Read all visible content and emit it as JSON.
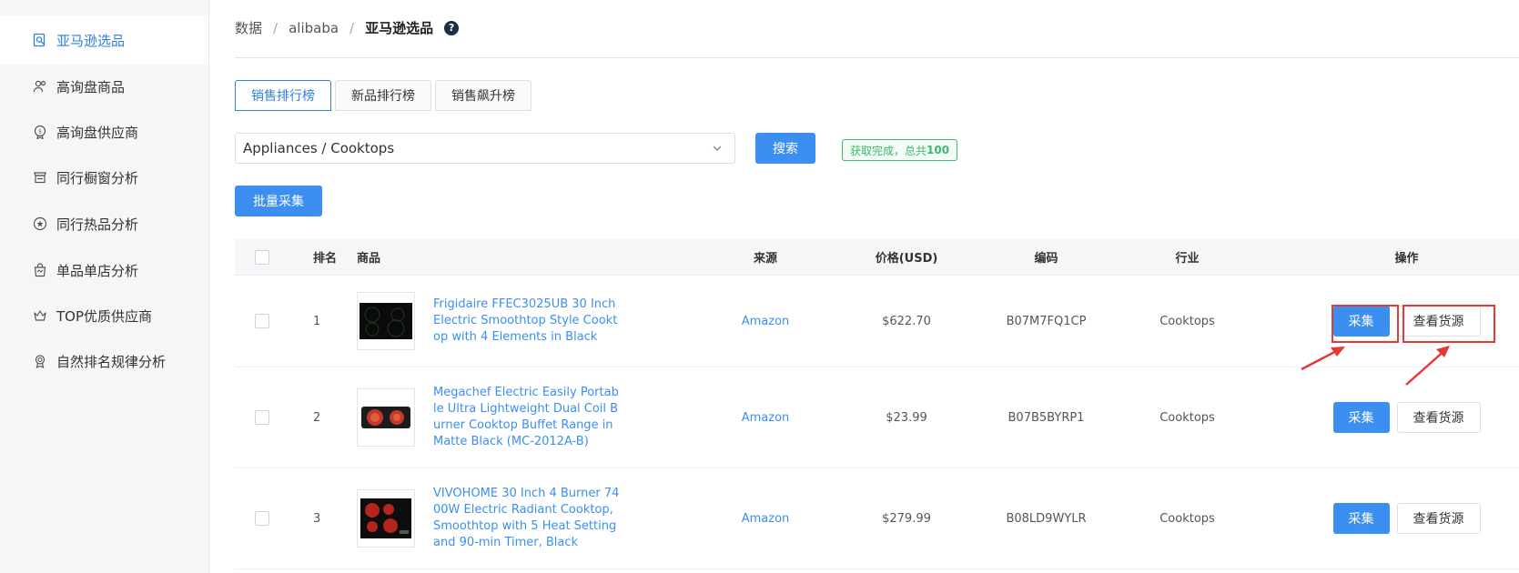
{
  "sidebar": {
    "items": [
      {
        "label": "亚马逊选品",
        "icon": "search-doc-icon",
        "active": true
      },
      {
        "label": "高询盘商品",
        "icon": "user-group-icon",
        "active": false
      },
      {
        "label": "高询盘供应商",
        "icon": "supplier-badge-icon",
        "active": false
      },
      {
        "label": "同行橱窗分析",
        "icon": "storefront-icon",
        "active": false
      },
      {
        "label": "同行热品分析",
        "icon": "star-circle-icon",
        "active": false
      },
      {
        "label": "单品单店分析",
        "icon": "shopping-bag-icon",
        "active": false
      },
      {
        "label": "TOP优质供应商",
        "icon": "crown-icon",
        "active": false
      },
      {
        "label": "自然排名规律分析",
        "icon": "award-icon",
        "active": false
      }
    ]
  },
  "breadcrumb": {
    "items": [
      "数据",
      "alibaba",
      "亚马逊选品"
    ],
    "help": "?"
  },
  "tabs": [
    {
      "label": "销售排行榜",
      "active": true
    },
    {
      "label": "新品排行榜",
      "active": false
    },
    {
      "label": "销售飙升榜",
      "active": false
    }
  ],
  "filter": {
    "category_value": "Appliances / Cooktops",
    "search_label": "搜索",
    "status_text": "获取完成，总共",
    "status_count": "100"
  },
  "batch_label": "批量采集",
  "table": {
    "headers": {
      "rank": "排名",
      "product": "商品",
      "source": "来源",
      "price": "价格(USD)",
      "code": "编码",
      "industry": "行业",
      "ops": "操作"
    },
    "rows": [
      {
        "rank": "1",
        "title": "Frigidaire FFEC3025UB 30 Inch Electric Smoothtop Style Cooktop with 4 Elements in Black",
        "source": "Amazon",
        "price": "$622.70",
        "code": "B07M7FQ1CP",
        "industry": "Cooktops",
        "collect": "采集",
        "view": "查看货源"
      },
      {
        "rank": "2",
        "title": "Megachef Electric Easily Portable Ultra Lightweight Dual Coil Burner Cooktop Buffet Range in Matte Black (MC-2012A-B)",
        "source": "Amazon",
        "price": "$23.99",
        "code": "B07B5BYRP1",
        "industry": "Cooktops",
        "collect": "采集",
        "view": "查看货源"
      },
      {
        "rank": "3",
        "title": "VIVOHOME 30 Inch 4 Burner 7400W Electric Radiant Cooktop, Smoothtop with 5 Heat Setting and 90-min Timer, Black",
        "source": "Amazon",
        "price": "$279.99",
        "code": "B08LD9WYLR",
        "industry": "Cooktops",
        "collect": "采集",
        "view": "查看货源"
      }
    ]
  },
  "colors": {
    "accent": "#3b8ff0",
    "success": "#3cba6d",
    "annotation": "#e53935"
  }
}
